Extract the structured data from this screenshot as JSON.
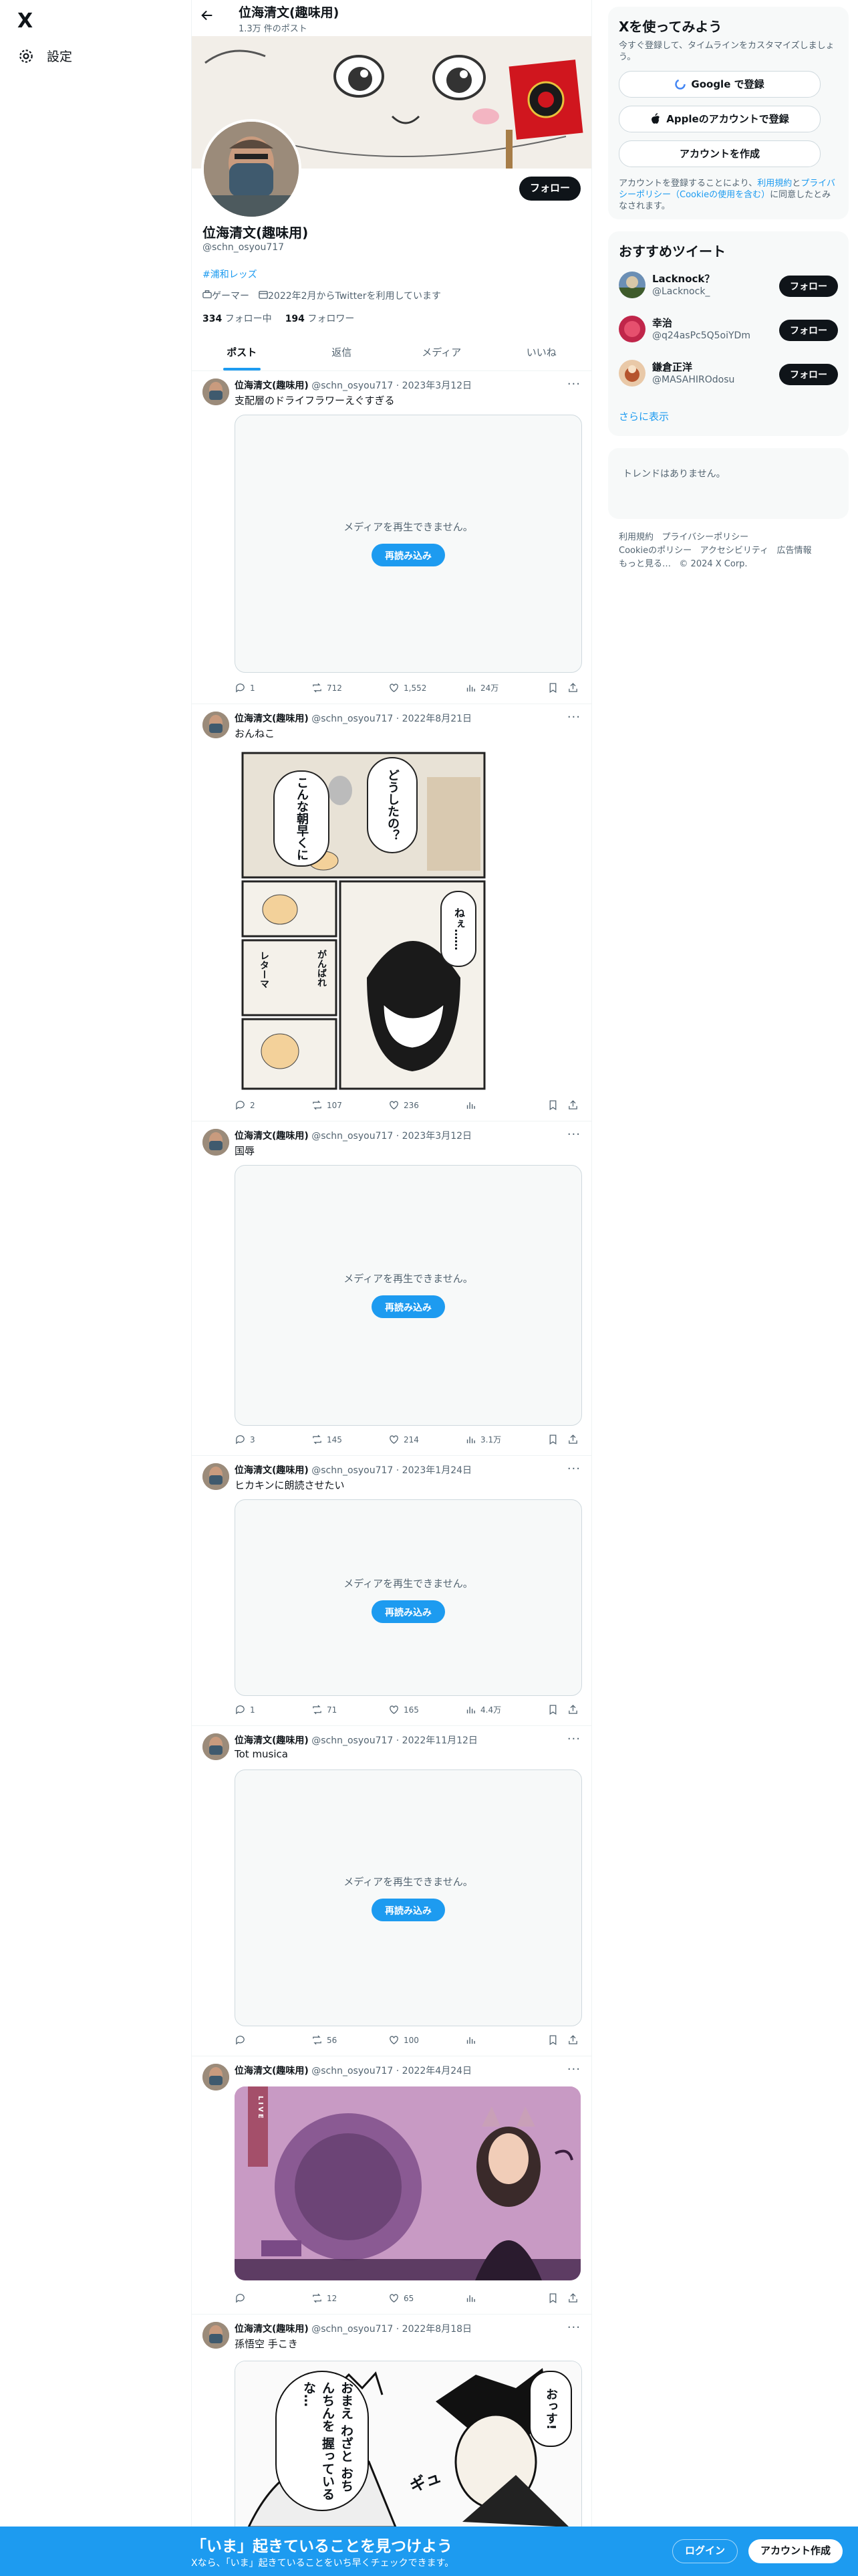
{
  "nav": {
    "logo": "X",
    "settings_label": "設定"
  },
  "header": {
    "name": "位海清文(趣味用)",
    "post_count": "1.3万 件のポスト",
    "back_icon": "arrow-left-icon"
  },
  "profile": {
    "name": "位海清文(趣味用)",
    "handle": "@schn_osyou717",
    "follow_label": "フォロー",
    "hashtag": "#浦和レッズ",
    "category": "ゲーマー",
    "joined": "2022年2月からTwitterを利用しています",
    "following_count": "334",
    "following_label": "フォロー中",
    "followers_count": "194",
    "followers_label": "フォロワー"
  },
  "tabs": [
    "ポスト",
    "返信",
    "メディア",
    "いいね"
  ],
  "media_unavailable": "メディアを再生できません。",
  "reload_label": "再読み込み",
  "tweets": [
    {
      "name": "位海清文(趣味用)",
      "handle": "@schn_osyou717",
      "date": "2023年3月12日",
      "text": "支配層のドライフラワーえぐすぎる",
      "reply": "1",
      "retweet": "712",
      "like": "1,552",
      "views": "24万"
    },
    {
      "name": "位海清文(趣味用)",
      "handle": "@schn_osyou717",
      "date": "2022年8月21日",
      "text": "おんねこ",
      "reply": "2",
      "retweet": "107",
      "like": "236",
      "views": ""
    },
    {
      "name": "位海清文(趣味用)",
      "handle": "@schn_osyou717",
      "date": "2023年3月12日",
      "text": "国辱",
      "reply": "3",
      "retweet": "145",
      "like": "214",
      "views": "3.1万"
    },
    {
      "name": "位海清文(趣味用)",
      "handle": "@schn_osyou717",
      "date": "2023年1月24日",
      "text": "ヒカキンに朗読させたい",
      "reply": "1",
      "retweet": "71",
      "like": "165",
      "views": "4.4万"
    },
    {
      "name": "位海清文(趣味用)",
      "handle": "@schn_osyou717",
      "date": "2022年11月12日",
      "text": "Tot musica",
      "reply": "",
      "retweet": "56",
      "like": "100",
      "views": ""
    },
    {
      "name": "位海清文(趣味用)",
      "handle": "@schn_osyou717",
      "date": "2022年4月24日",
      "text": "",
      "reply": "",
      "retweet": "12",
      "like": "65",
      "views": ""
    },
    {
      "name": "位海清文(趣味用)",
      "handle": "@schn_osyou717",
      "date": "2022年8月18日",
      "text": "孫悟空 手こき"
    }
  ],
  "signup": {
    "title": "Xを使ってみよう",
    "subtitle": "今すぐ登録して、タイムラインをカスタマイズしましょう。",
    "google_label": "Google で登録",
    "apple_label": "Appleのアカウントで登録",
    "create_label": "アカウントを作成",
    "legal_prefix": "アカウントを登録することにより、",
    "legal_link1": "利用規約",
    "legal_mid": "と",
    "legal_link2": "プライバシーポリシー（Cookieの使用を含む）",
    "legal_suffix": "に同意したとみなされます。"
  },
  "recommend": {
    "title": "おすすめツイート",
    "follow_label": "フォロー",
    "users": [
      {
        "name": "Lacknock？",
        "handle": "@Lacknock_"
      },
      {
        "name": "幸治",
        "handle": "@q24asPc5Q5oiYDm"
      },
      {
        "name": "鎌倉正洋",
        "handle": "@MASAHIROdosu"
      }
    ],
    "more": "さらに表示"
  },
  "trends": {
    "empty": "トレンドはありません。"
  },
  "footer": {
    "links": [
      "利用規約",
      "プライバシーポリシー",
      "Cookieのポリシー",
      "アクセシビリティ",
      "広告情報",
      "もっと見る…",
      "© 2024 X Corp."
    ]
  },
  "bottom_bar": {
    "title": "「いま」起きていることを見つけよう",
    "subtitle": "Xなら、「いま」起きていることをいち早くチェックできます。",
    "login": "ログイン",
    "signup": "アカウント作成"
  },
  "image_text": {
    "manga_bubble1": "どうしたの？",
    "manga_bubble2": "こんな朝早くに",
    "manga_bubble3": "ねぇ……",
    "manga_bubble4": "がんばれ",
    "manga_bubble5": "レターマ",
    "live_label": "LIVE",
    "comic_bubble1": "おっす!",
    "comic_bubble2": "おまえ わざと おちんちんを 握っているな…",
    "comic_sfx": "ギュ"
  },
  "colors": {
    "accent": "#1d9bf0",
    "text": "#0f1419",
    "muted": "#536471"
  }
}
